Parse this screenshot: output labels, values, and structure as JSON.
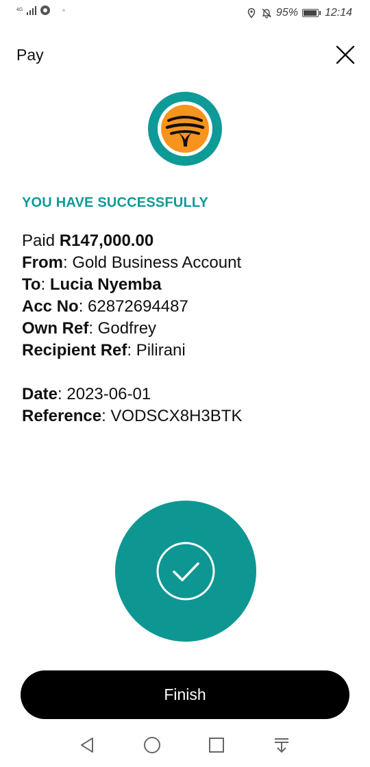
{
  "status_bar": {
    "network": "4G",
    "battery": "95%",
    "battery_level": 0.95,
    "time": "12:14"
  },
  "header": {
    "title": "Pay"
  },
  "colors": {
    "teal": "#0e9a97",
    "logo_orange": "#f7941d",
    "button_black": "#000000"
  },
  "success": {
    "heading": "YOU HAVE SUCCESSFULLY"
  },
  "details": {
    "paid_label": "Paid",
    "amount": "R147,000.00",
    "from_label": "From",
    "from_value": ": Gold Business Account",
    "to_label": "To",
    "to_sep": ": ",
    "to_value": "Lucia Nyemba",
    "acc_label": "Acc No",
    "acc_value": ": 62872694487",
    "own_ref_label": "Own Ref",
    "own_ref_value": ": Godfrey",
    "recipient_ref_label": "Recipient Ref",
    "recipient_ref_value": ": Pilirani",
    "date_label": "Date",
    "date_value": ": 2023-06-01",
    "reference_label": "Reference",
    "reference_value": ": VODSCX8H3BTK"
  },
  "actions": {
    "finish_label": "Finish"
  },
  "icons": {
    "close": "close-icon",
    "check": "check-circle-icon",
    "logo": "fnb-tree-logo",
    "nav_back": "back-triangle-icon",
    "nav_home": "home-circle-icon",
    "nav_recents": "recents-square-icon",
    "nav_notifications": "notification-pull-icon"
  }
}
